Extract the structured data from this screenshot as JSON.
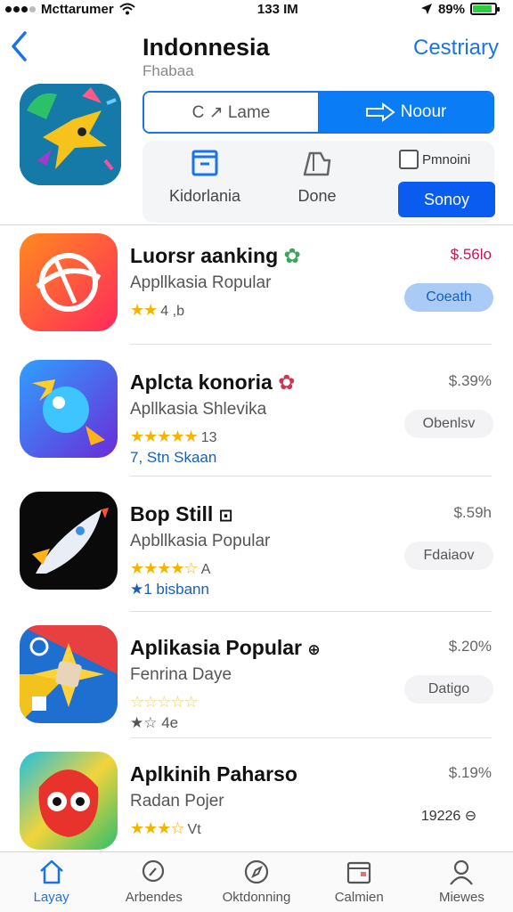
{
  "status": {
    "carrier": "Mcttarumer",
    "time": "133 IM",
    "battery": "89%",
    "battery_level": 0.89
  },
  "header": {
    "title": "Indonnesia",
    "subtitle": "Fhabaa",
    "action": "Cestriary"
  },
  "segmented": {
    "left_label": "C ↗ Lame",
    "right_label": "Noour"
  },
  "filters": {
    "item1": "Kidorlania",
    "item2": "Done",
    "checkbox_label": "Pmnoini",
    "sort_button": "Sonoy"
  },
  "apps": [
    {
      "name": "Luorsr aanking",
      "sub": "Appllkasia Ropular",
      "stars": "★★",
      "rating_count": "4 ,b",
      "extra": "",
      "price": "$.56lo",
      "button": "Coeath",
      "price_color": "#c2185b",
      "button_color": "#aacbf5"
    },
    {
      "name": "Aplcta konoria",
      "sub": "Apllkasia Shlevika",
      "stars": "★★★★★",
      "rating_count": "13",
      "extra": "7, Stn Skaan",
      "price": "$.39%",
      "button": "Obenlsv"
    },
    {
      "name": "Bop Still",
      "sub": "Apbllkasia Popular",
      "stars": "★★★★☆",
      "rating_count": "A",
      "extra": "★1 bisbann",
      "price": "$.59h",
      "button": "Fdaiaov"
    },
    {
      "name": "Aplikasia Popular",
      "sub": "Fenrina Daye",
      "stars": "☆☆☆☆☆",
      "rating_count": "",
      "extra": "★☆ 4e",
      "price": "$.20%",
      "button": "Datigo"
    },
    {
      "name": "Aplkinih Paharso",
      "sub": "Radan Pojer",
      "stars": "★★★☆",
      "rating_count": "Vt",
      "extra": "",
      "price": "$.19%",
      "button": "19226 ⊖"
    }
  ],
  "tabs": [
    {
      "label": "Layay",
      "icon": "home-icon"
    },
    {
      "label": "Arbendes",
      "icon": "search-icon"
    },
    {
      "label": "Oktdonning",
      "icon": "discover-icon"
    },
    {
      "label": "Calmien",
      "icon": "calendar-icon"
    },
    {
      "label": "Miewes",
      "icon": "profile-icon"
    }
  ],
  "colors": {
    "accent": "#1a73e8",
    "star": "#f5b400"
  }
}
